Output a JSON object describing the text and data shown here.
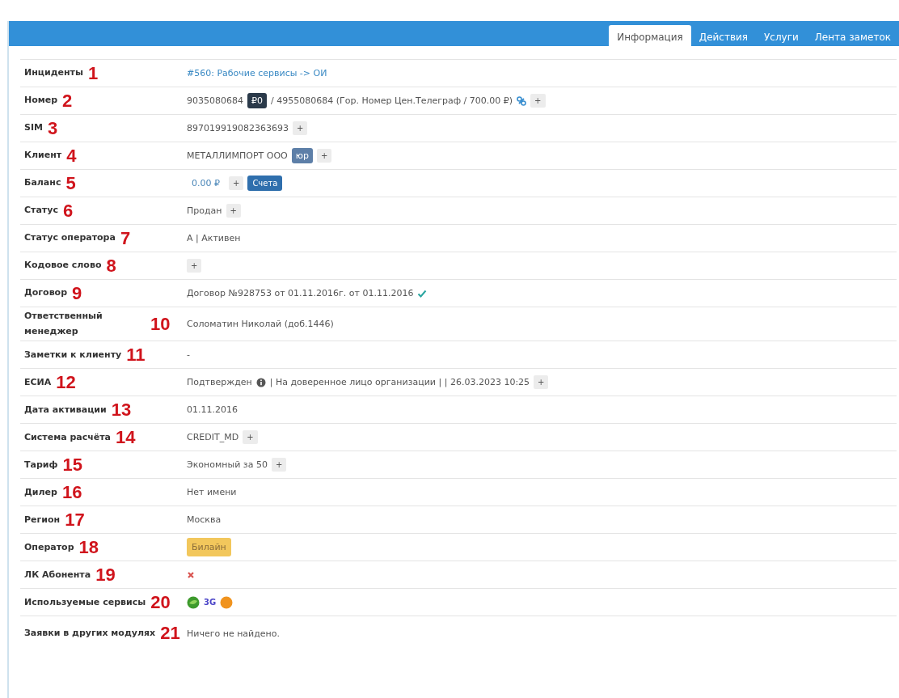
{
  "tabs": [
    {
      "label": "Информация",
      "selected": true
    },
    {
      "label": "Действия",
      "selected": false
    },
    {
      "label": "Услуги",
      "selected": false
    },
    {
      "label": "Лента заметок",
      "selected": false
    }
  ],
  "rows": [
    {
      "label": "Инциденты",
      "marker": "1",
      "value": [
        {
          "kind": "link",
          "text": "#560: Рабочие сервисы -> ОИ"
        }
      ]
    },
    {
      "label": "Номер",
      "marker": "2",
      "value": [
        {
          "kind": "text",
          "text": "9035080684"
        },
        {
          "kind": "balance",
          "text": "₽0"
        },
        {
          "kind": "text",
          "text": "/ 4955080684 (Гор. Номер Цен.Телеграф / 700.00 ₽)"
        },
        {
          "kind": "linkmark"
        },
        {
          "kind": "plus",
          "text": "+"
        }
      ]
    },
    {
      "label": "SIM",
      "marker": "3",
      "value": [
        {
          "kind": "text",
          "text": "897019919082363693"
        },
        {
          "kind": "plus",
          "text": "+"
        }
      ]
    },
    {
      "label": "Клиент",
      "marker": "4",
      "value": [
        {
          "kind": "text",
          "text": "МЕТАЛЛИМПОРТ ООО"
        },
        {
          "kind": "type",
          "text": "юр"
        },
        {
          "kind": "plus",
          "text": "+"
        }
      ]
    },
    {
      "label": "Баланс",
      "marker": "5",
      "value": [
        {
          "kind": "amount",
          "text": "0.00 ₽"
        },
        {
          "kind": "plus",
          "text": "+"
        },
        {
          "kind": "button",
          "text": "Счета"
        }
      ]
    },
    {
      "label": "Статус",
      "marker": "6",
      "value": [
        {
          "kind": "text",
          "text": "Продан"
        },
        {
          "kind": "plus",
          "text": "+"
        }
      ]
    },
    {
      "label": "Статус оператора",
      "marker": "7",
      "value": [
        {
          "kind": "text",
          "text": "А | Активен"
        }
      ]
    },
    {
      "label": "Кодовое слово",
      "marker": "8",
      "value": [
        {
          "kind": "plus",
          "text": "+"
        }
      ]
    },
    {
      "label": "Договор",
      "marker": "9",
      "value": [
        {
          "kind": "text",
          "text": "Договор №928753 от 01.11.2016г. от 01.11.2016"
        },
        {
          "kind": "check"
        }
      ]
    },
    {
      "label": "Ответственный менеджер",
      "marker": "10",
      "value": [
        {
          "kind": "text",
          "text": "Соломатин Николай (доб.1446)"
        }
      ]
    },
    {
      "label": "Заметки к клиенту",
      "marker": "11",
      "value": [
        {
          "kind": "text",
          "text": "-"
        }
      ]
    },
    {
      "label": "ЕСИА",
      "marker": "12",
      "value": [
        {
          "kind": "text",
          "text": "Подтвержден"
        },
        {
          "kind": "info"
        },
        {
          "kind": "text",
          "text": "| На доверенное лицо организации | | 26.03.2023 10:25"
        },
        {
          "kind": "plus",
          "text": "+"
        }
      ]
    },
    {
      "label": "Дата активации",
      "marker": "13",
      "value": [
        {
          "kind": "text",
          "text": "01.11.2016"
        }
      ]
    },
    {
      "label": "Система расчёта",
      "marker": "14",
      "value": [
        {
          "kind": "text",
          "text": "CREDIT_MD"
        },
        {
          "kind": "plus",
          "text": "+"
        }
      ]
    },
    {
      "label": "Тариф",
      "marker": "15",
      "value": [
        {
          "kind": "text",
          "text": "Экономный за 50"
        },
        {
          "kind": "plus",
          "text": "+"
        }
      ]
    },
    {
      "label": "Дилер",
      "marker": "16",
      "value": [
        {
          "kind": "text",
          "text": "Нет имени"
        }
      ]
    },
    {
      "label": "Регион",
      "marker": "17",
      "value": [
        {
          "kind": "text",
          "text": "Москва"
        }
      ]
    },
    {
      "label": "Оператор",
      "marker": "18",
      "value": [
        {
          "kind": "operator",
          "text": "Билайн"
        }
      ]
    },
    {
      "label": "ЛК Абонента",
      "marker": "19",
      "value": [
        {
          "kind": "cross"
        }
      ]
    },
    {
      "label": "Используемые сервисы",
      "marker": "20",
      "value": [
        {
          "kind": "leaf"
        },
        {
          "kind": "tag",
          "text": "3G"
        },
        {
          "kind": "coin"
        }
      ]
    },
    {
      "label": "Заявки в других модулях",
      "marker": "21",
      "value": [
        {
          "kind": "text",
          "text": "Ничего не найдено."
        }
      ]
    }
  ]
}
